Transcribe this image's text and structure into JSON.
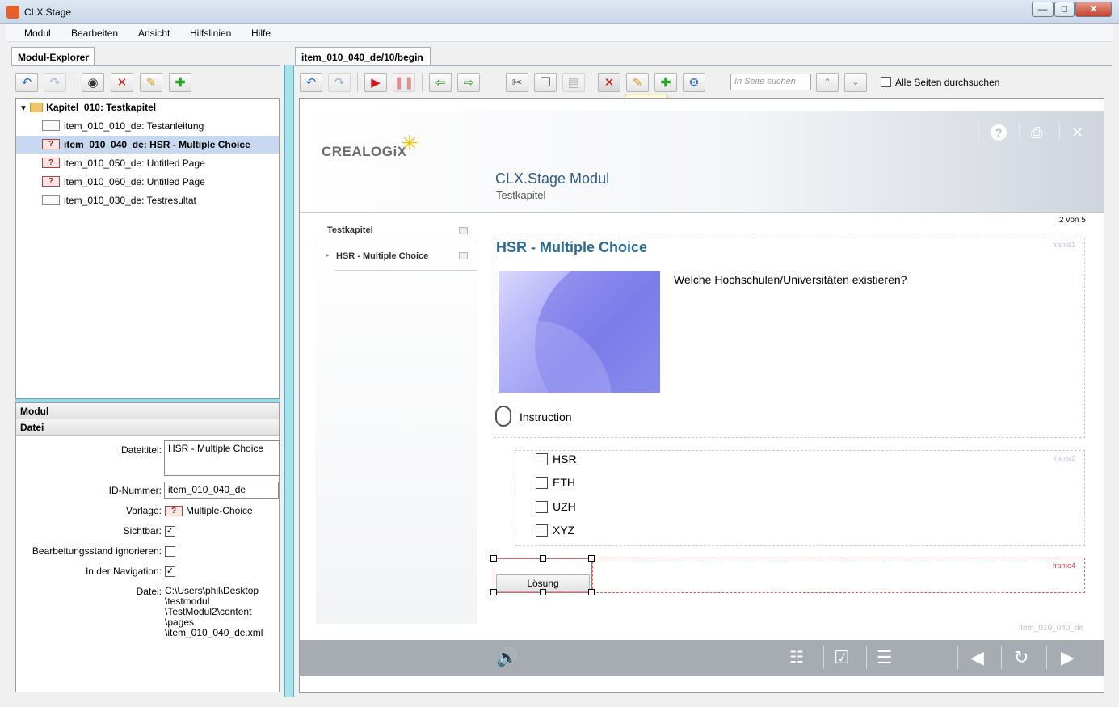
{
  "window": {
    "title": "CLX.Stage"
  },
  "menu": {
    "items": [
      "Modul",
      "Bearbeiten",
      "Ansicht",
      "Hilfslinien",
      "Hilfe"
    ]
  },
  "left_panel": {
    "tab": "Modul-Explorer",
    "tree": {
      "root": "Kapitel_010: Testkapitel",
      "items": [
        {
          "label": "item_010_010_de: Testanleitung",
          "icon": "page-icon"
        },
        {
          "label": "item_010_040_de: HSR - Multiple Choice",
          "icon": "question-icon",
          "selected": true
        },
        {
          "label": "item_010_050_de: Untitled Page",
          "icon": "question-icon"
        },
        {
          "label": "item_010_060_de: Untitled Page",
          "icon": "question-icon"
        },
        {
          "label": "item_010_030_de: Testresultat",
          "icon": "page-icon"
        }
      ]
    },
    "properties": {
      "section_modul": "Modul",
      "section_datei": "Datei",
      "dateititel_label": "Dateititel:",
      "dateititel_value": "HSR - Multiple Choice",
      "id_label": "ID-Nummer:",
      "id_value": "item_010_040_de",
      "vorlage_label": "Vorlage:",
      "vorlage_value": "Multiple-Choice",
      "sichtbar_label": "Sichtbar:",
      "sichtbar_checked": true,
      "bearbeitung_label": "Bearbeitungsstand ignorieren:",
      "bearbeitung_checked": false,
      "navigation_label": "In der Navigation:",
      "navigation_checked": true,
      "datei_label": "Datei:",
      "datei_lines": [
        "C:\\Users\\phil\\Desktop",
        "\\testmodul",
        "\\TestModul2\\content",
        "\\pages",
        "\\item_010_040_de.xml"
      ]
    }
  },
  "right_panel": {
    "tab": "item_010_040_de/10/begin",
    "search_placeholder": "In Seite suchen",
    "search_all_label": "Alle Seiten durchsuchen",
    "search_all_checked": false,
    "tooltip": "Löschen",
    "stage": {
      "logo": "CREALOGiX",
      "module_title": "CLX.Stage Modul",
      "module_subtitle": "Testkapitel",
      "page_counter": "2 von 5",
      "nav": {
        "chapter": "Testkapitel",
        "page": "HSR - Multiple Choice"
      },
      "page_heading": "HSR - Multiple Choice",
      "question": "Welche Hochschulen/Universitäten existieren?",
      "instruction": "Instruction",
      "frame_labels": {
        "frame1": "frame1",
        "frame2": "frame2",
        "frame4": "frame4"
      },
      "options": [
        "HSR",
        "ETH",
        "UZH",
        "XYZ"
      ],
      "solution_button": "Lösung",
      "footer_id": "item_010_040_de"
    }
  }
}
